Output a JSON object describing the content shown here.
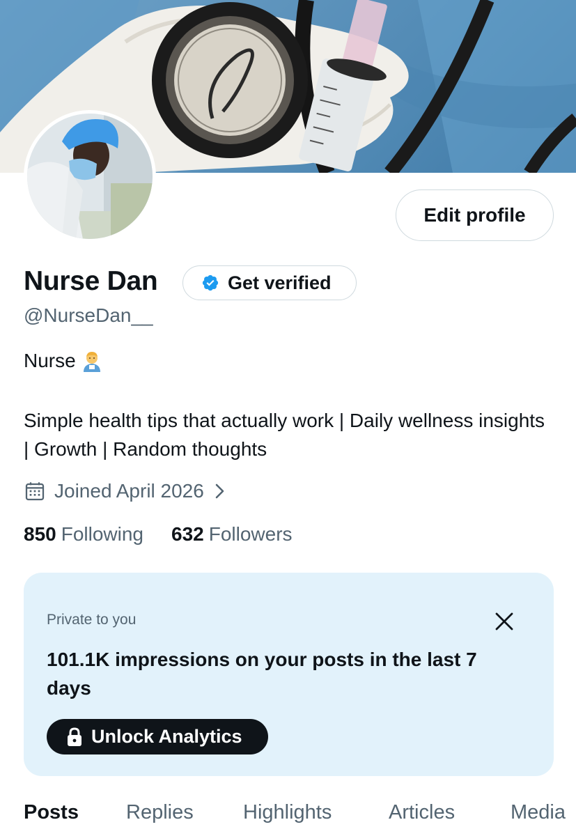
{
  "profile": {
    "name": "Nurse Dan",
    "handle": "@NurseDan__",
    "bio_line1": "Nurse",
    "bio_emoji": "nurse-emoji",
    "bio_line2": "Simple health tips that actually work | Daily wellness insights | Growth | Random thoughts",
    "joined": "Joined April 2026"
  },
  "buttons": {
    "edit_profile": "Edit profile",
    "get_verified": "Get verified",
    "unlock_analytics": "Unlock Analytics"
  },
  "stats": {
    "following_count": "850",
    "following_label": "Following",
    "followers_count": "632",
    "followers_label": "Followers"
  },
  "private_card": {
    "label": "Private to you",
    "headline": "101.1K impressions on your posts in the last 7 days"
  },
  "tabs": [
    {
      "label": "Posts",
      "active": true
    },
    {
      "label": "Replies",
      "active": false
    },
    {
      "label": "Highlights",
      "active": false
    },
    {
      "label": "Articles",
      "active": false
    },
    {
      "label": "Media",
      "active": false
    }
  ],
  "colors": {
    "accent": "#1d9bf0",
    "text_primary": "#0f1419",
    "text_secondary": "#536471",
    "card_bg": "#e2f2fb"
  },
  "icons": [
    "verified-badge-icon",
    "calendar-icon",
    "chevron-right-icon",
    "close-icon",
    "lock-icon"
  ]
}
